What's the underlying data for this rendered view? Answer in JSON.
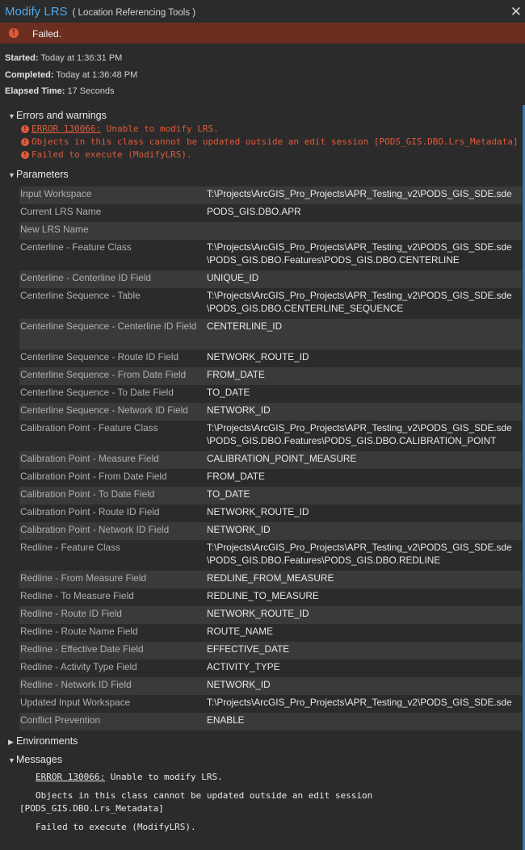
{
  "window": {
    "title": "Modify LRS",
    "subtitle": "( Location Referencing Tools )"
  },
  "status": {
    "text": "Failed.",
    "color": "#6a2f20"
  },
  "meta": {
    "started_label": "Started:",
    "started_value": "Today at 1:36:31 PM",
    "completed_label": "Completed:",
    "completed_value": "Today at 1:36:48 PM",
    "elapsed_label": "Elapsed Time:",
    "elapsed_value": "17 Seconds"
  },
  "errors": {
    "heading": "Errors and warnings",
    "code": "ERROR 130066:",
    "line1_rest": " Unable to modify LRS.",
    "line2": "Objects in this class cannot be updated outside an edit session [PODS_GIS.DBO.Lrs_Metadata]",
    "line3": "Failed to execute (ModifyLRS)."
  },
  "parameters": {
    "heading": "Parameters",
    "rows": [
      {
        "name": "Input Workspace",
        "value": "T:\\Projects\\ArcGIS_Pro_Projects\\APR_Testing_v2\\PODS_GIS_SDE.sde",
        "value2": ""
      },
      {
        "name": "Current LRS Name",
        "value": "PODS_GIS.DBO.APR",
        "value2": ""
      },
      {
        "name": "New LRS Name",
        "value": "",
        "value2": ""
      },
      {
        "name": "Centerline - Feature Class",
        "value": "T:\\Projects\\ArcGIS_Pro_Projects\\APR_Testing_v2\\PODS_GIS_SDE.sde",
        "value2": "\\PODS_GIS.DBO.Features\\PODS_GIS.DBO.CENTERLINE"
      },
      {
        "name": "Centerline - Centerline ID Field",
        "value": "UNIQUE_ID",
        "value2": ""
      },
      {
        "name": "Centerline Sequence - Table",
        "value": "T:\\Projects\\ArcGIS_Pro_Projects\\APR_Testing_v2\\PODS_GIS_SDE.sde",
        "value2": "\\PODS_GIS.DBO.CENTERLINE_SEQUENCE"
      },
      {
        "name": "Centerline Sequence - Centerline ID Field",
        "value": "CENTERLINE_ID",
        "value2": ""
      },
      {
        "name": "Centerline Sequence - Route ID Field",
        "value": "NETWORK_ROUTE_ID",
        "value2": ""
      },
      {
        "name": "Centerline Sequence - From Date Field",
        "value": "FROM_DATE",
        "value2": ""
      },
      {
        "name": "Centerline Sequence - To Date Field",
        "value": "TO_DATE",
        "value2": ""
      },
      {
        "name": "Centerline Sequence - Network ID Field",
        "value": "NETWORK_ID",
        "value2": ""
      },
      {
        "name": "Calibration Point - Feature Class",
        "value": "T:\\Projects\\ArcGIS_Pro_Projects\\APR_Testing_v2\\PODS_GIS_SDE.sde",
        "value2": "\\PODS_GIS.DBO.Features\\PODS_GIS.DBO.CALIBRATION_POINT"
      },
      {
        "name": "Calibration Point - Measure Field",
        "value": "CALIBRATION_POINT_MEASURE",
        "value2": ""
      },
      {
        "name": "Calibration Point - From Date Field",
        "value": "FROM_DATE",
        "value2": ""
      },
      {
        "name": "Calibration Point - To Date Field",
        "value": "TO_DATE",
        "value2": ""
      },
      {
        "name": "Calibration Point - Route ID Field",
        "value": "NETWORK_ROUTE_ID",
        "value2": ""
      },
      {
        "name": "Calibration Point - Network ID Field",
        "value": "NETWORK_ID",
        "value2": ""
      },
      {
        "name": "Redline - Feature Class",
        "value": "T:\\Projects\\ArcGIS_Pro_Projects\\APR_Testing_v2\\PODS_GIS_SDE.sde",
        "value2": "\\PODS_GIS.DBO.Features\\PODS_GIS.DBO.REDLINE"
      },
      {
        "name": "Redline - From Measure Field",
        "value": "REDLINE_FROM_MEASURE",
        "value2": ""
      },
      {
        "name": "Redline - To Measure Field",
        "value": "REDLINE_TO_MEASURE",
        "value2": ""
      },
      {
        "name": "Redline - Route ID Field",
        "value": "NETWORK_ROUTE_ID",
        "value2": ""
      },
      {
        "name": "Redline - Route Name Field",
        "value": "ROUTE_NAME",
        "value2": ""
      },
      {
        "name": "Redline - Effective Date Field",
        "value": "EFFECTIVE_DATE",
        "value2": ""
      },
      {
        "name": "Redline - Activity Type Field",
        "value": "ACTIVITY_TYPE",
        "value2": ""
      },
      {
        "name": "Redline - Network ID Field",
        "value": "NETWORK_ID",
        "value2": ""
      },
      {
        "name": "Updated Input Workspace",
        "value": "T:\\Projects\\ArcGIS_Pro_Projects\\APR_Testing_v2\\PODS_GIS_SDE.sde",
        "value2": ""
      },
      {
        "name": "Conflict Prevention",
        "value": "ENABLE",
        "value2": ""
      }
    ]
  },
  "environments": {
    "heading": "Environments"
  },
  "messages": {
    "heading": "Messages",
    "code": "ERROR 130066:",
    "line1_rest": " Unable to modify LRS.",
    "line2a": "Objects in this class cannot be updated outside an edit session",
    "line2b": "[PODS_GIS.DBO.Lrs_Metadata]",
    "line3": "Failed to execute (ModifyLRS)."
  },
  "colors": {
    "accent": "#4ea8ec",
    "error": "#e05a3a",
    "background": "#2b2b2b"
  }
}
